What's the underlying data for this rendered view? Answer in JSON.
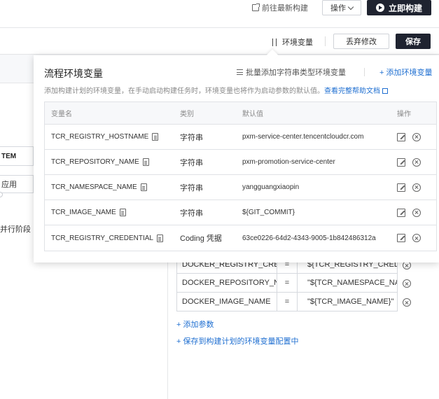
{
  "header": {
    "goto_latest": "前往最新构建",
    "operations": "操作",
    "build_now": "立即构建"
  },
  "toolbar": {
    "env_vars": "环境变量",
    "discard": "丢弃修改",
    "save": "保存"
  },
  "left_panel": {
    "item1": "TEM",
    "item2": "应用",
    "item3": "并行阶段"
  },
  "popover": {
    "title": "流程环境变量",
    "batch_add": "批量添加字符串类型环境变量",
    "add_env": "+ 添加环境变量",
    "description": "添加构建计划的环境变量，在手动启动构建任务时，环境变量也将作为启动参数的默认值。",
    "help_link": "查看完整帮助文档",
    "columns": [
      "变量名",
      "类别",
      "默认值",
      "操作"
    ],
    "rows": [
      {
        "name": "TCR_REGISTRY_HOSTNAME",
        "type": "字符串",
        "value": "pxm-service-center.tencentcloudcr.com"
      },
      {
        "name": "TCR_REPOSITORY_NAME",
        "type": "字符串",
        "value": "pxm-promotion-service-center"
      },
      {
        "name": "TCR_NAMESPACE_NAME",
        "type": "字符串",
        "value": "yangguangxiaopin"
      },
      {
        "name": "TCR_IMAGE_NAME",
        "type": "字符串",
        "value": "${GIT_COMMIT}"
      },
      {
        "name": "TCR_REGISTRY_CREDENTIAL",
        "type": "Coding 凭据",
        "value": "63ce0226-64d2-4343-9005-1b842486312a"
      }
    ]
  },
  "params": {
    "rows": [
      {
        "key": "DOCKER_REGISTRY_CRED",
        "eq": "=",
        "value": "${TCR_REGISTRY_CREDE"
      },
      {
        "key": "DOCKER_REPOSITORY_NA",
        "eq": "=",
        "value": "\"${TCR_NAMESPACE_NAM"
      },
      {
        "key": "DOCKER_IMAGE_NAME",
        "eq": "=",
        "value": "\"${TCR_IMAGE_NAME}\""
      }
    ],
    "add_param": "+ 添加参数",
    "save_to_config": "+ 保存到构建计划的环境变量配置中"
  },
  "colors": {
    "primary_dark": "#1f2330",
    "link_blue": "#1f6fd1"
  }
}
